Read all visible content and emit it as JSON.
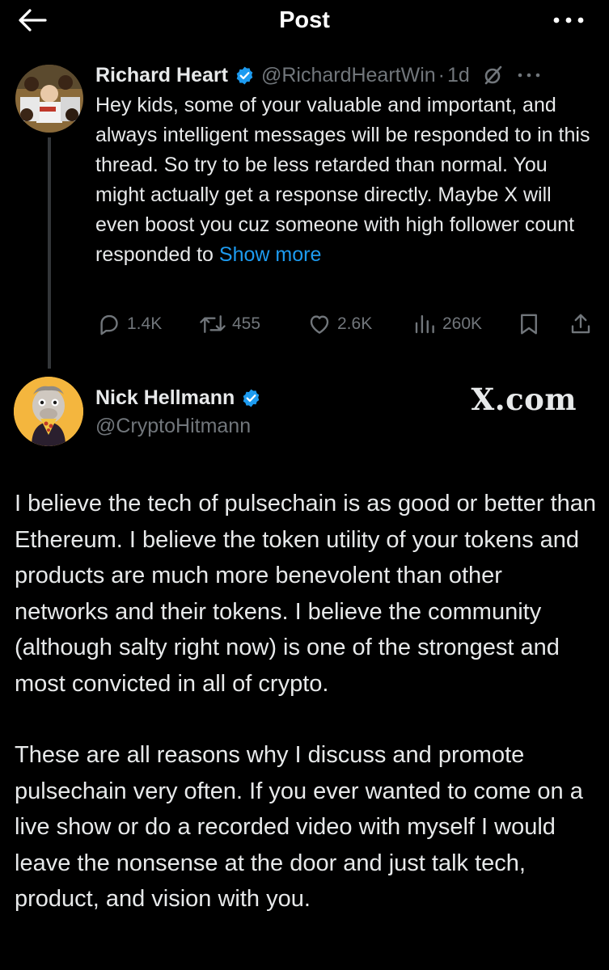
{
  "header": {
    "title": "Post",
    "back_icon": "arrow-left-icon",
    "more_icon": "more-horizontal-icon"
  },
  "reply_to": {
    "display_name": "Richard Heart",
    "handle": "@RichardHeartWin",
    "separator": "·",
    "time": "1d",
    "text": "Hey kids, some of your valuable and important, and always intelligent messages will be responded to in this thread. So try to be less retarded than normal. You might actually get a response directly. Maybe X will even boost you cuz someone with high follower count responded to",
    "show_more": "Show more",
    "stats": {
      "replies": "1.4K",
      "reposts": "455",
      "likes": "2.6K",
      "views": "260K"
    }
  },
  "post": {
    "display_name": "Nick Hellmann",
    "handle": "@CryptoHitmann",
    "watermark": "X.com",
    "paragraphs": [
      "I believe the tech of pulsechain is as good or better than Ethereum. I believe the token utility of your tokens and products are much more benevolent than other networks and their tokens. I believe the community (although salty right now) is one of the strongest and most convicted in all of crypto.",
      "These are all reasons why I discuss and promote pulsechain very often. If you ever wanted to come on a live show or do a recorded video with myself I would leave the nonsense at the door and just talk tech, product, and vision with you."
    ]
  },
  "colors": {
    "background": "#000000",
    "text": "#e7e9ea",
    "secondary": "#71767b",
    "link": "#1d9bf0",
    "verified": "#1d9bf0"
  }
}
